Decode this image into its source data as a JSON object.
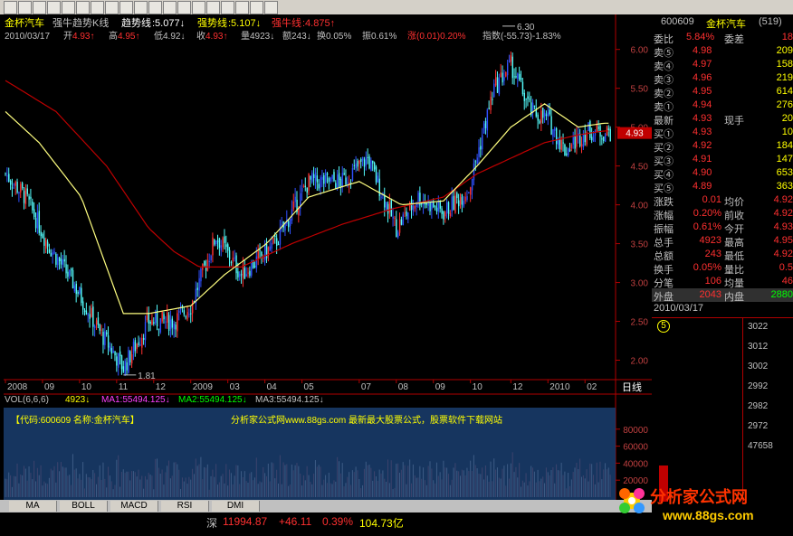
{
  "toolbar": {
    "icons": [
      "file-icon",
      "print-icon",
      "back-icon",
      "forward-icon",
      "refresh-icon",
      "cursor-icon",
      "zoom-icon",
      "line-icon",
      "rect-icon",
      "text-icon",
      "grid-icon",
      "chart-icon",
      "list-icon",
      "table-icon",
      "help-icon",
      "info-icon",
      "window-icon",
      "save-icon",
      "menu-icon"
    ]
  },
  "header": {
    "stock_name": "金杯汽车",
    "indicator_name": "强牛趋势K线",
    "trend_label": "趋势线",
    "trend_value": ":5.077↓",
    "strong_label": "强势线",
    "strong_value": ":5.107↓",
    "bull_label": "强牛线",
    "bull_value": ":4.875↑"
  },
  "info_line": {
    "date": "2010/03/17",
    "open_label": "开",
    "open": "4.93↑",
    "high_label": "高",
    "high": "4.95↑",
    "low_label": "低",
    "low": "4.92↓",
    "close_label": "收",
    "close": "4.93↑",
    "vol_label": "量",
    "vol": "4923↓",
    "amount_label": "额",
    "amount": "243↓",
    "turnover_label": "换",
    "turnover": "0.05%",
    "amplitude_label": "振",
    "amplitude": "0.61%",
    "change_label": "涨",
    "change": "(0.01)0.20%",
    "index_label": "指数",
    "index": "(-55.73)-1.83%"
  },
  "volume_header": {
    "label": "VOL(6,6,6)",
    "value": "4923↓",
    "ma1": "MA1:55494.125↓",
    "ma2": "MA2:55494.125↓",
    "ma3": "MA3:55494.125↓"
  },
  "watermark": {
    "code": "【代码:600609 名称:金杯汽车】",
    "site": "分析家公式网www.88gs.com 最新最大股票公式，股票软件下载网站"
  },
  "bottom_tabs": [
    "MA",
    "BOLL",
    "MACD",
    "RSI",
    "DMI"
  ],
  "status_bar": {
    "market": "深",
    "index_value": "11994.87",
    "change": "+46.11",
    "pct": "0.39%",
    "amount": "104.73亿"
  },
  "logo": {
    "text": "分析家公式网",
    "url": "www.88gs.com"
  },
  "side_panel": {
    "code": "600609",
    "name": "金杯汽车",
    "number": "(519)",
    "weibi_label": "委比",
    "weibi": "5.84%",
    "weicha_label": "委差",
    "weicha": "18",
    "sell": [
      {
        "label": "卖⑤",
        "price": "4.98",
        "vol": "209"
      },
      {
        "label": "卖④",
        "price": "4.97",
        "vol": "158"
      },
      {
        "label": "卖③",
        "price": "4.96",
        "vol": "219"
      },
      {
        "label": "卖②",
        "price": "4.95",
        "vol": "614"
      },
      {
        "label": "卖①",
        "price": "4.94",
        "vol": "276"
      }
    ],
    "latest_label": "最新",
    "latest": "4.93",
    "hand_label": "现手",
    "hand": "20",
    "buy": [
      {
        "label": "买①",
        "price": "4.93",
        "vol": "10"
      },
      {
        "label": "买②",
        "price": "4.92",
        "vol": "184"
      },
      {
        "label": "买③",
        "price": "4.91",
        "vol": "147"
      },
      {
        "label": "买④",
        "price": "4.90",
        "vol": "653"
      },
      {
        "label": "买⑤",
        "price": "4.89",
        "vol": "363"
      }
    ],
    "stats": [
      {
        "l1": "涨跌",
        "v1": "0.01",
        "l2": "均价",
        "v2": "4.92"
      },
      {
        "l1": "涨幅",
        "v1": "0.20%",
        "l2": "前收",
        "v2": "4.92"
      },
      {
        "l1": "振幅",
        "v1": "0.61%",
        "l2": "今开",
        "v2": "4.93"
      },
      {
        "l1": "总手",
        "v1": "4923",
        "l2": "最高",
        "v2": "4.95"
      },
      {
        "l1": "总额",
        "v1": "243",
        "l2": "最低",
        "v2": "4.92"
      },
      {
        "l1": "换手",
        "v1": "0.05%",
        "l2": "量比",
        "v2": "0.5"
      },
      {
        "l1": "分笔",
        "v1": "106",
        "l2": "均量",
        "v2": "46"
      }
    ],
    "outer_label": "外盘",
    "outer": "2043",
    "inner_label": "内盘",
    "inner": "2880",
    "date": "2010/03/17",
    "badge": "5",
    "mini_ticks": [
      "3022",
      "3012",
      "3002",
      "2992",
      "2982",
      "2972",
      "47658"
    ]
  },
  "colors": {
    "up": "#ff3030",
    "down": "#54fcfc",
    "blue_candle": "#3050ff",
    "ma_yellow": "#ffff80",
    "ma_red": "#c00000",
    "axis": "#b00000",
    "text_cyan": "#00ffff",
    "text_yellow": "#ffff00"
  },
  "chart_data": {
    "type": "candlestick",
    "price_ticks": [
      "6.00",
      "5.50",
      "5.00",
      "4.50",
      "4.00",
      "3.50",
      "3.00",
      "2.50",
      "2.00"
    ],
    "ylim": [
      1.75,
      6.45
    ],
    "x_labels": [
      "2008",
      "09",
      "10",
      "11",
      "12",
      "2009",
      "03",
      "04",
      "05",
      "07",
      "08",
      "09",
      "10",
      "12",
      "2010",
      "02"
    ],
    "x_positions_idx": [
      0,
      22,
      44,
      66,
      88,
      110,
      132,
      154,
      176,
      210,
      232,
      254,
      276,
      300,
      322,
      344
    ],
    "annotations": [
      {
        "text": "6.30",
        "value": 6.3,
        "idx": 295
      },
      {
        "text": "1.81",
        "value": 1.81,
        "idx": 70
      }
    ],
    "current_price_label": "4.93",
    "period_label": "日线",
    "close_series_anchors": [
      [
        0,
        4.4
      ],
      [
        12,
        4.1
      ],
      [
        25,
        3.5
      ],
      [
        40,
        3.0
      ],
      [
        55,
        2.4
      ],
      [
        70,
        1.9
      ],
      [
        85,
        2.5
      ],
      [
        100,
        2.5
      ],
      [
        110,
        2.7
      ],
      [
        125,
        3.6
      ],
      [
        140,
        3.1
      ],
      [
        160,
        3.5
      ],
      [
        180,
        4.3
      ],
      [
        200,
        4.3
      ],
      [
        215,
        4.6
      ],
      [
        232,
        3.7
      ],
      [
        245,
        4.1
      ],
      [
        260,
        3.9
      ],
      [
        275,
        4.2
      ],
      [
        290,
        5.5
      ],
      [
        300,
        5.8
      ],
      [
        312,
        5.2
      ],
      [
        322,
        5.1
      ],
      [
        332,
        4.7
      ],
      [
        345,
        4.95
      ],
      [
        355,
        4.93
      ]
    ],
    "ma_yellow_anchors": [
      [
        0,
        5.2
      ],
      [
        20,
        4.8
      ],
      [
        45,
        4.1
      ],
      [
        70,
        2.6
      ],
      [
        85,
        2.6
      ],
      [
        110,
        2.7
      ],
      [
        130,
        3.1
      ],
      [
        155,
        3.5
      ],
      [
        180,
        4.1
      ],
      [
        210,
        4.3
      ],
      [
        235,
        4.0
      ],
      [
        260,
        4.05
      ],
      [
        280,
        4.5
      ],
      [
        300,
        5.0
      ],
      [
        320,
        5.3
      ],
      [
        340,
        5.0
      ],
      [
        355,
        5.05
      ]
    ],
    "ma_red_anchors": [
      [
        0,
        5.6
      ],
      [
        30,
        5.2
      ],
      [
        60,
        4.5
      ],
      [
        85,
        3.7
      ],
      [
        100,
        3.4
      ],
      [
        115,
        3.2
      ],
      [
        140,
        3.2
      ],
      [
        170,
        3.5
      ],
      [
        200,
        3.75
      ],
      [
        230,
        3.95
      ],
      [
        260,
        4.1
      ],
      [
        280,
        4.4
      ],
      [
        300,
        4.6
      ],
      [
        320,
        4.8
      ],
      [
        340,
        4.9
      ],
      [
        355,
        4.95
      ]
    ],
    "volume_ticks": [
      "80000",
      "60000",
      "40000",
      "20000"
    ],
    "volume_ylim": [
      0,
      100000
    ]
  }
}
